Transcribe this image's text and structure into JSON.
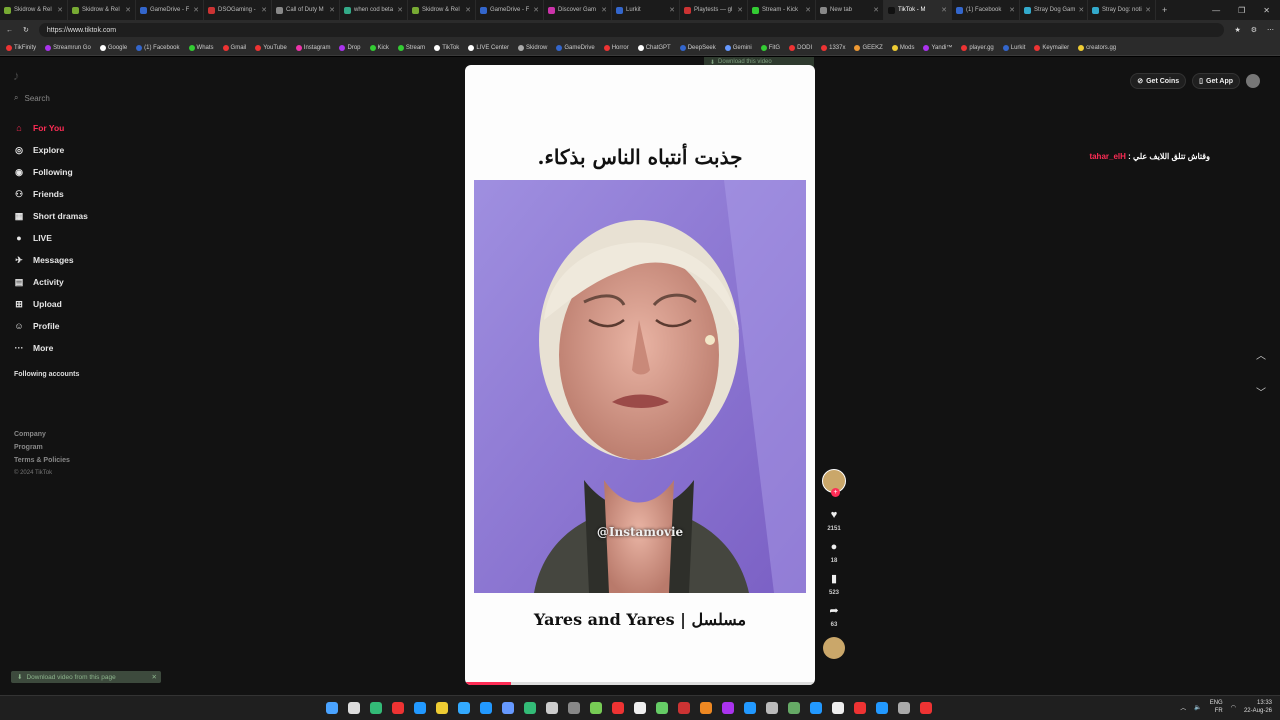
{
  "browser": {
    "tabs": [
      {
        "label": "Skidrow & Rel",
        "color": "#7a3"
      },
      {
        "label": "Skidrow & Rel",
        "color": "#7a3"
      },
      {
        "label": "GameDrive - F",
        "color": "#36c"
      },
      {
        "label": "DSOGaming -",
        "color": "#c33"
      },
      {
        "label": "Call of Duty M",
        "color": "#888"
      },
      {
        "label": "when cod beta",
        "color": "#3a8"
      },
      {
        "label": "Skidrow & Rel",
        "color": "#7a3"
      },
      {
        "label": "GameDrive - F",
        "color": "#36c"
      },
      {
        "label": "Discover Gam",
        "color": "#c3a"
      },
      {
        "label": "Lurkit",
        "color": "#36c"
      },
      {
        "label": "Playtests — gl",
        "color": "#c33"
      },
      {
        "label": "Stream - Kick",
        "color": "#3c3"
      },
      {
        "label": "New tab",
        "color": "#888"
      },
      {
        "label": "TikTok - M",
        "color": "#111",
        "active": true
      },
      {
        "label": "(1) Facebook",
        "color": "#36c"
      },
      {
        "label": "Stray Dog Gam",
        "color": "#3ac"
      },
      {
        "label": "Stray Dog: noti",
        "color": "#3ac"
      }
    ],
    "new_tab": "+",
    "window_controls": [
      "—",
      "❐",
      "✕"
    ],
    "url": "https://www.tiktok.com",
    "bookmarks": [
      {
        "label": "TikFinity",
        "color": "#e33"
      },
      {
        "label": "Streamrun Go",
        "color": "#a3e"
      },
      {
        "label": "Google",
        "color": "#fff"
      },
      {
        "label": "(1) Facebook",
        "color": "#36c"
      },
      {
        "label": "Whats",
        "color": "#3c3"
      },
      {
        "label": "Gmail",
        "color": "#e33"
      },
      {
        "label": "YouTube",
        "color": "#e33"
      },
      {
        "label": "Instagram",
        "color": "#e3a"
      },
      {
        "label": "Drop",
        "color": "#a3e"
      },
      {
        "label": "Kick",
        "color": "#3c3"
      },
      {
        "label": "Stream",
        "color": "#3c3"
      },
      {
        "label": "TikTok",
        "color": "#fff"
      },
      {
        "label": "LIVE Center",
        "color": "#fff"
      },
      {
        "label": "Skidrow",
        "color": "#aaa"
      },
      {
        "label": "GameDrive",
        "color": "#36c"
      },
      {
        "label": "Horror",
        "color": "#e33"
      },
      {
        "label": "ChatGPT",
        "color": "#fff"
      },
      {
        "label": "DeepSeek",
        "color": "#36c"
      },
      {
        "label": "Gemini",
        "color": "#69f"
      },
      {
        "label": "FitG",
        "color": "#3c3"
      },
      {
        "label": "DODI",
        "color": "#e33"
      },
      {
        "label": "1337x",
        "color": "#e33"
      },
      {
        "label": "GEEKZ",
        "color": "#e93"
      },
      {
        "label": "Mods",
        "color": "#ec3"
      },
      {
        "label": "Yandi™",
        "color": "#a3e"
      },
      {
        "label": "player.gg",
        "color": "#e33"
      },
      {
        "label": "Lurkit",
        "color": "#36c"
      },
      {
        "label": "Keymailer",
        "color": "#e33"
      },
      {
        "label": "creators.gg",
        "color": "#ec3"
      }
    ]
  },
  "sidebar": {
    "search_placeholder": "Search",
    "items": [
      {
        "label": "For You",
        "icon": "home-icon",
        "glyph": "⌂"
      },
      {
        "label": "Explore",
        "icon": "compass-icon",
        "glyph": "◎"
      },
      {
        "label": "Following",
        "icon": "following-icon",
        "glyph": "◉"
      },
      {
        "label": "Friends",
        "icon": "friends-icon",
        "glyph": "⚇"
      },
      {
        "label": "Short dramas",
        "icon": "film-icon",
        "glyph": "▦"
      },
      {
        "label": "LIVE",
        "icon": "live-icon",
        "glyph": "●"
      },
      {
        "label": "Messages",
        "icon": "messages-icon",
        "glyph": "✈"
      },
      {
        "label": "Activity",
        "icon": "activity-icon",
        "glyph": "▤"
      },
      {
        "label": "Upload",
        "icon": "upload-icon",
        "glyph": "⊞"
      },
      {
        "label": "Profile",
        "icon": "profile-icon",
        "glyph": "☺"
      },
      {
        "label": "More",
        "icon": "more-icon",
        "glyph": "···"
      }
    ],
    "following_accounts": "Following accounts",
    "footer": [
      "Company",
      "Program",
      "Terms & Policies"
    ],
    "copyright": "© 2024 TikTok",
    "download_pill": "Download video from this page"
  },
  "header": {
    "get_coins": "Get Coins",
    "get_app": "Get App"
  },
  "comment": {
    "text": "وقتاش تتلق اللايف علي :",
    "user": "tahar_elH"
  },
  "video": {
    "download_badge": "Download this video",
    "caption_top": "جذبت أنتباه الناس بذكاء.",
    "watermark": "@Instamovie",
    "caption_bottom": "Yares and Yares | مسلسل",
    "progress": 0.13,
    "actions": {
      "likes": "2151",
      "comments": "18",
      "saves": "523",
      "shares": "63"
    }
  },
  "taskbar": {
    "icons": [
      "#4aa3ff",
      "#ddd",
      "#3b7",
      "#e33",
      "#29f",
      "#ec3",
      "#3af",
      "#29f",
      "#69f",
      "#3b7",
      "#ccc",
      "#888",
      "#7c5",
      "#e33",
      "#eee",
      "#6c6",
      "#c33",
      "#e82",
      "#a3e",
      "#29f",
      "#bbb",
      "#6a6",
      "#29f",
      "#eee",
      "#e33",
      "#29f",
      "#aaa",
      "#e33"
    ],
    "lang": "ENG",
    "region": "FR",
    "time": "13:33",
    "date": "22-Aug-26"
  }
}
